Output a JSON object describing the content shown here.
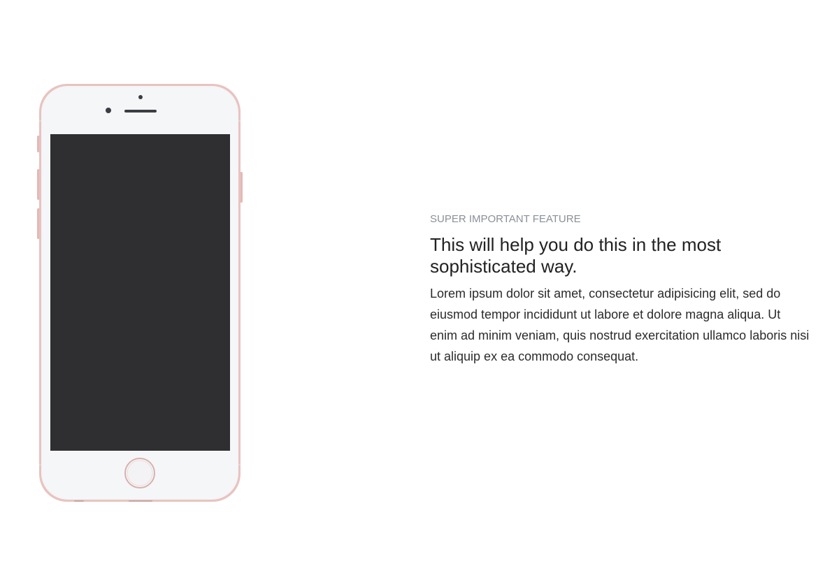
{
  "feature": {
    "eyebrow": "SUPER IMPORTANT FEATURE",
    "headline": "This will help you do this in the most sophisticated way.",
    "body": "Lorem ipsum dolor sit amet, consectetur adipisicing elit, sed do eiusmod tempor incididunt ut labore et dolore magna aliqua. Ut enim ad minim veniam, quis nostrud exercitation ullamco laboris nisi ut aliquip ex ea commodo consequat."
  },
  "colors": {
    "background": "#ffffff",
    "phone_frame": "#e8c3c0",
    "phone_face": "#f5f6f8",
    "phone_screen": "#2f2f31",
    "eyebrow_text": "#8a9099",
    "headline_text": "#222222",
    "body_text": "#2b2b2b"
  }
}
